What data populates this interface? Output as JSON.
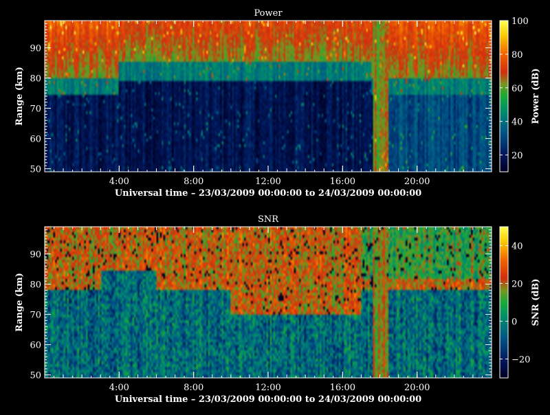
{
  "chart_data": [
    {
      "type": "heatmap",
      "title": "Power",
      "xlabel": "Universal time – 23/03/2009 00:00:00 to 24/03/2009 00:00:00",
      "ylabel": "Range (km)",
      "x_unit": "hours UT",
      "xlim": [
        0,
        24
      ],
      "ylim": [
        49,
        99
      ],
      "x_ticks": [
        {
          "v": 4,
          "label": "4:00"
        },
        {
          "v": 8,
          "label": "8:00"
        },
        {
          "v": 12,
          "label": "12:00"
        },
        {
          "v": 16,
          "label": "16:00"
        },
        {
          "v": 20,
          "label": "20:00"
        }
      ],
      "y_ticks": [
        {
          "v": 50,
          "label": "50"
        },
        {
          "v": 60,
          "label": "60"
        },
        {
          "v": 70,
          "label": "70"
        },
        {
          "v": 80,
          "label": "80"
        },
        {
          "v": 90,
          "label": "90"
        }
      ],
      "colorbar": {
        "label": "Power (dB)",
        "range": [
          10,
          100
        ],
        "ticks": [
          {
            "v": 20,
            "label": "20"
          },
          {
            "v": 40,
            "label": "40"
          },
          {
            "v": 60,
            "label": "60"
          },
          {
            "v": 80,
            "label": "80"
          },
          {
            "v": 100,
            "label": "100"
          }
        ]
      },
      "features": {
        "high_layer_top_km": 99,
        "high_layer_bottom_km_night": 80,
        "high_layer_bottom_km_day": 85,
        "high_layer_value": 62,
        "quiet_region_value": 18,
        "transition_value": 42,
        "daytime_hours": [
          4.2,
          17.5
        ],
        "evening_region_value": 30,
        "strong_vertical_band_hours": [
          17.6,
          18.5
        ],
        "strong_band_value": 64
      }
    },
    {
      "type": "heatmap",
      "title": "SNR",
      "xlabel": "Universal time – 23/03/2009 00:00:00 to 24/03/2009 00:00:00",
      "ylabel": "Range (km)",
      "x_unit": "hours UT",
      "xlim": [
        0,
        24
      ],
      "ylim": [
        49,
        99
      ],
      "x_ticks": [
        {
          "v": 4,
          "label": "4:00"
        },
        {
          "v": 8,
          "label": "8:00"
        },
        {
          "v": 12,
          "label": "12:00"
        },
        {
          "v": 16,
          "label": "16:00"
        },
        {
          "v": 20,
          "label": "20:00"
        }
      ],
      "y_ticks": [
        {
          "v": 50,
          "label": "50"
        },
        {
          "v": 60,
          "label": "60"
        },
        {
          "v": 70,
          "label": "70"
        },
        {
          "v": 80,
          "label": "80"
        },
        {
          "v": 90,
          "label": "90"
        }
      ],
      "colorbar": {
        "label": "SNR (dB)",
        "range": [
          -30,
          50
        ],
        "ticks": [
          {
            "v": -20,
            "label": "−20"
          },
          {
            "v": 0,
            "label": "0"
          },
          {
            "v": 20,
            "label": "20"
          },
          {
            "v": 40,
            "label": "40"
          }
        ]
      },
      "features": {
        "high_layer_value": 22,
        "low_region_value": -5,
        "strong_vertical_band_hours": [
          17.6,
          18.5
        ]
      }
    }
  ]
}
